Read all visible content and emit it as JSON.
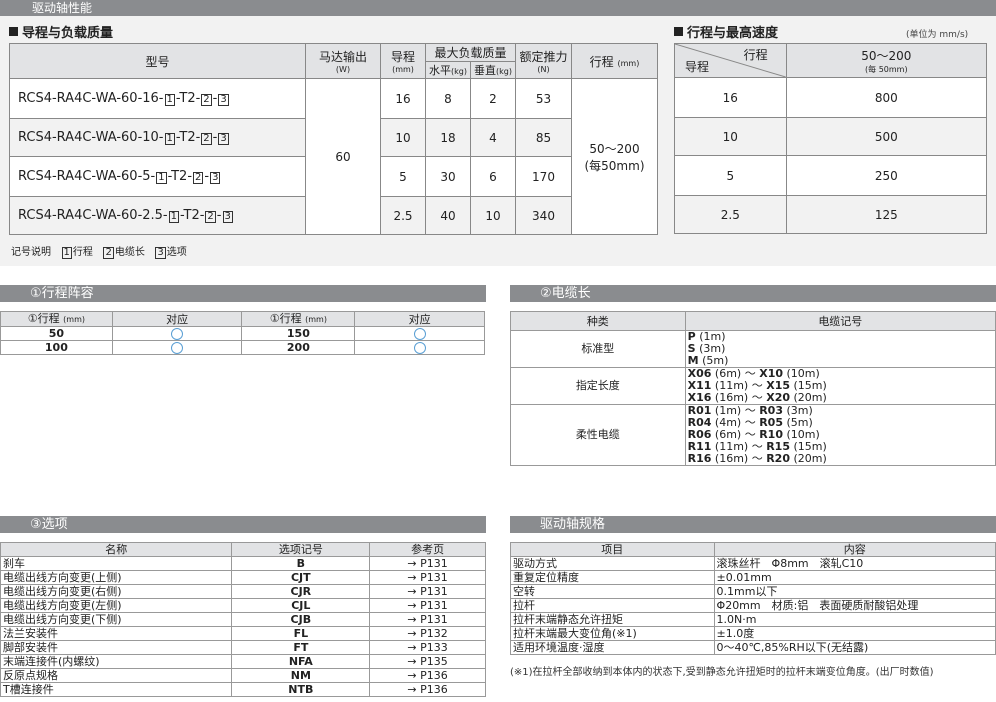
{
  "top_bar": "驱动轴性能",
  "perf": {
    "title": "导程与负载质量",
    "headers": {
      "model": "型号",
      "motor": "马达输出",
      "motor_unit": "(W)",
      "lead": "导程",
      "lead_unit": "(mm)",
      "maxload": "最大负载质量",
      "horiz": "水平",
      "horiz_unit": "(kg)",
      "vert": "垂直",
      "vert_unit": "(kg)",
      "thrust": "额定推力",
      "thrust_unit": "(N)",
      "stroke": "行程",
      "stroke_unit": "(mm)"
    },
    "motor_value": "60",
    "stroke_value": "50～200",
    "stroke_note": "(每50mm)",
    "rows": [
      {
        "model_prefix": "RCS4-RA4C-WA-60-16-",
        "lead": "16",
        "horiz": "8",
        "vert": "2",
        "thrust": "53"
      },
      {
        "model_prefix": "RCS4-RA4C-WA-60-10-",
        "lead": "10",
        "horiz": "18",
        "vert": "4",
        "thrust": "85"
      },
      {
        "model_prefix": "RCS4-RA4C-WA-60-5-",
        "lead": "5",
        "horiz": "30",
        "vert": "6",
        "thrust": "170"
      },
      {
        "model_prefix": "RCS4-RA4C-WA-60-2.5-",
        "lead": "2.5",
        "horiz": "40",
        "vert": "10",
        "thrust": "340"
      }
    ],
    "model_suffix": {
      "b1": "1",
      "t2": "-T2-",
      "b2": "2",
      "dash": "-",
      "b3": "3"
    },
    "legend": {
      "label": "记号说明",
      "i1": "1",
      "t1": "行程",
      "i2": "2",
      "t2": "电缆长",
      "i3": "3",
      "t3": "选项"
    }
  },
  "speed": {
    "title": "行程与最高速度",
    "unit": "(单位为 mm/s)",
    "stroke_head": "行程",
    "lead_head": "导程",
    "range": "50～200",
    "range_note": "(每 50mm)",
    "rows": [
      {
        "lead": "16",
        "speed": "800"
      },
      {
        "lead": "10",
        "speed": "500"
      },
      {
        "lead": "5",
        "speed": "250"
      },
      {
        "lead": "2.5",
        "speed": "125"
      }
    ]
  },
  "stroke_list": {
    "title": "①行程阵容",
    "h_stroke": "①行程",
    "h_unit": "(mm)",
    "h_support": "对应",
    "rows": [
      [
        "50",
        "150"
      ],
      [
        "100",
        "200"
      ]
    ]
  },
  "cable": {
    "title": "②电缆长",
    "h_kind": "种类",
    "h_code": "电缆记号",
    "groups": [
      {
        "kind": "标准型",
        "items": [
          [
            "P",
            "(1m)"
          ],
          [
            "S",
            "(3m)"
          ],
          [
            "M",
            "(5m)"
          ]
        ]
      },
      {
        "kind": "指定长度",
        "items": [
          [
            "X06",
            "(6m)",
            "X10",
            "(10m)"
          ],
          [
            "X11",
            "(11m)",
            "X15",
            "(15m)"
          ],
          [
            "X16",
            "(16m)",
            "X20",
            "(20m)"
          ]
        ]
      },
      {
        "kind": "柔性电缆",
        "items": [
          [
            "R01",
            "(1m)",
            "R03",
            "(3m)"
          ],
          [
            "R04",
            "(4m)",
            "R05",
            "(5m)"
          ],
          [
            "R06",
            "(6m)",
            "R10",
            "(10m)"
          ],
          [
            "R11",
            "(11m)",
            "R15",
            "(15m)"
          ],
          [
            "R16",
            "(16m)",
            "R20",
            "(20m)"
          ]
        ]
      }
    ],
    "tilde": "～"
  },
  "options": {
    "title": "③选项",
    "h_name": "名称",
    "h_code": "选项记号",
    "h_page": "参考页",
    "rows": [
      [
        "刹车",
        "B",
        "→ P131"
      ],
      [
        "电缆出线方向变更(上侧)",
        "CJT",
        "→ P131"
      ],
      [
        "电缆出线方向变更(右侧)",
        "CJR",
        "→ P131"
      ],
      [
        "电缆出线方向变更(左侧)",
        "CJL",
        "→ P131"
      ],
      [
        "电缆出线方向变更(下侧)",
        "CJB",
        "→ P131"
      ],
      [
        "法兰安装件",
        "FL",
        "→ P132"
      ],
      [
        "脚部安装件",
        "FT",
        "→ P133"
      ],
      [
        "末端连接件(内螺纹)",
        "NFA",
        "→ P135"
      ],
      [
        "反原点规格",
        "NM",
        "→ P136"
      ],
      [
        "T槽连接件",
        "NTB",
        "→ P136"
      ]
    ]
  },
  "spec": {
    "title": "驱动轴规格",
    "h_item": "项目",
    "h_content": "内容",
    "rows": [
      [
        "驱动方式",
        "滚珠丝杆　Φ8mm　滚轧C10"
      ],
      [
        "重复定位精度",
        "±0.01mm"
      ],
      [
        "空转",
        "0.1mm以下"
      ],
      [
        "拉杆",
        "Φ20mm　材质:铝　表面硬质耐酸铝处理"
      ],
      [
        "拉杆末端静态允许扭矩",
        "1.0N·m"
      ],
      [
        "拉杆末端最大变位角(※1)",
        "±1.0度"
      ],
      [
        "适用环境温度·湿度",
        "0～40℃,85%RH以下(无结露)"
      ]
    ],
    "note": "(※1)在拉杆全部收纳到本体内的状态下,受到静态允许扭矩时的拉杆末端变位角度。(出厂时数值)"
  }
}
